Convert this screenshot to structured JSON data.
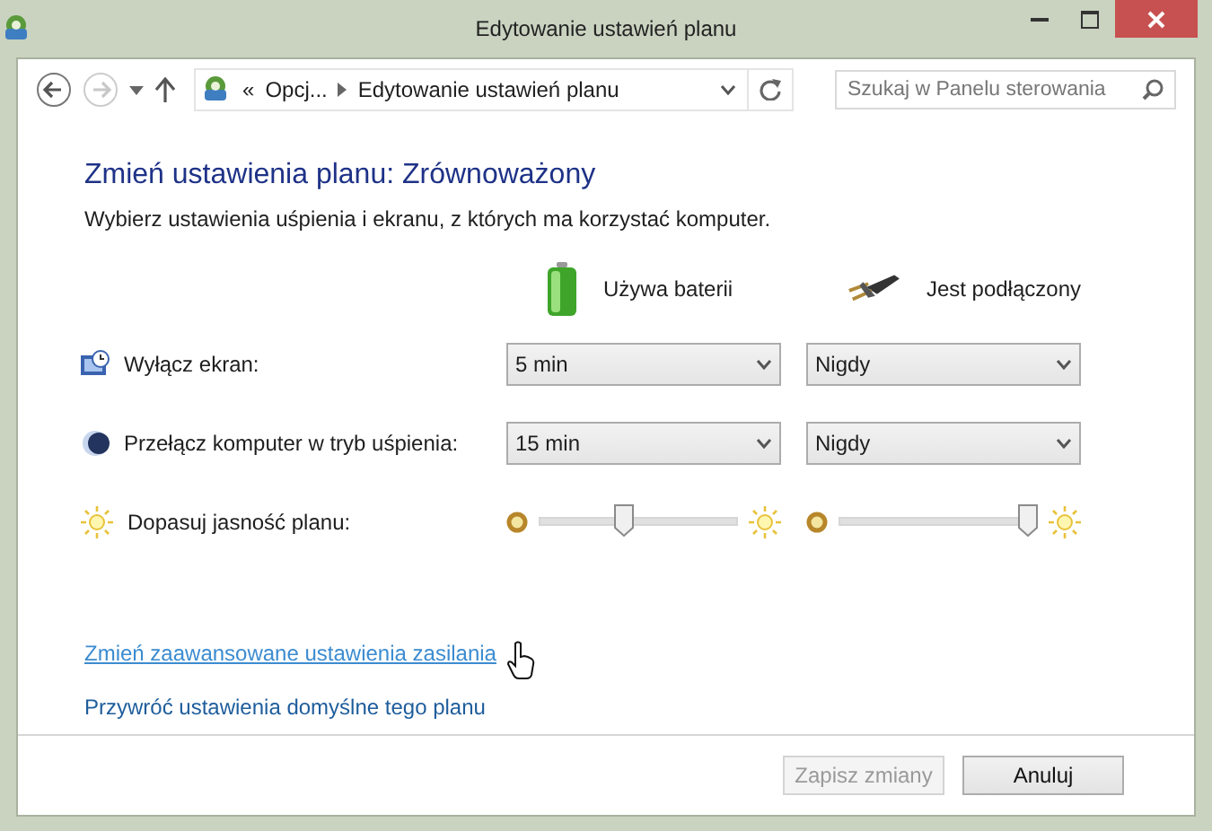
{
  "window": {
    "title": "Edytowanie ustawień planu"
  },
  "address_bar": {
    "overflow": "«",
    "crumbs": [
      "Opcj...",
      "Edytowanie ustawień planu"
    ]
  },
  "search": {
    "placeholder": "Szukaj w Panelu sterowania"
  },
  "heading": "Zmień ustawienia planu: Zrównoważony",
  "description": "Wybierz ustawienia uśpienia i ekranu, z których ma korzystać komputer.",
  "columns": [
    {
      "kind": "battery",
      "label": "Używa baterii"
    },
    {
      "kind": "plug",
      "label": "Jest podłączony"
    }
  ],
  "settings": [
    {
      "kind": "dropdown",
      "label": "Wyłącz ekran:",
      "values": [
        "5 min",
        "Nigdy"
      ]
    },
    {
      "kind": "dropdown",
      "label": "Przełącz komputer w tryb uśpienia:",
      "values": [
        "15 min",
        "Nigdy"
      ]
    },
    {
      "kind": "slider",
      "label": "Dopasuj jasność planu:",
      "levels": [
        {
          "level": 0.42
        },
        {
          "level": 0.95
        }
      ]
    }
  ],
  "links": [
    {
      "text": "Zmień zaawansowane ustawienia zasilania",
      "hovered": true
    },
    {
      "text": "Przywróć ustawienia domyślne tego planu",
      "hovered": false
    }
  ],
  "buttons": [
    {
      "label": "Zapisz zmiany",
      "disabled": true
    },
    {
      "label": "Anuluj",
      "disabled": false
    }
  ]
}
